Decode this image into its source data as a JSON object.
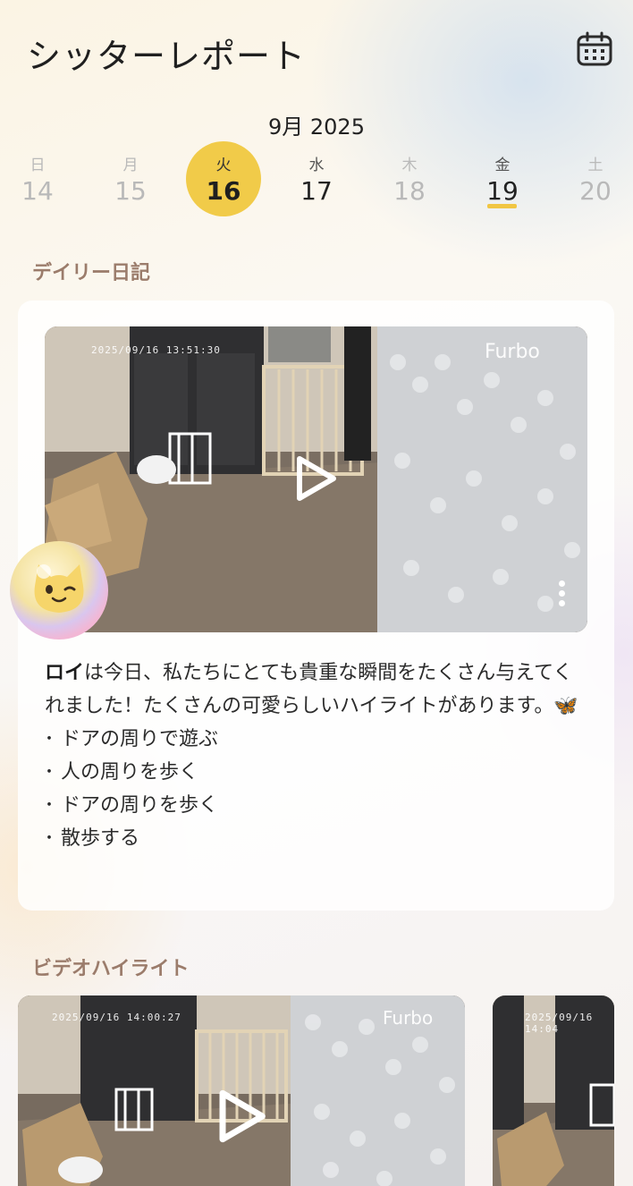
{
  "header": {
    "title": "シッターレポート",
    "calendar_icon": "calendar-icon"
  },
  "calendar": {
    "month_label": "9月 2025",
    "days": [
      {
        "dow": "日",
        "num": "14",
        "state": "disabled"
      },
      {
        "dow": "月",
        "num": "15",
        "state": "disabled"
      },
      {
        "dow": "火",
        "num": "16",
        "state": "selected"
      },
      {
        "dow": "水",
        "num": "17",
        "state": "available"
      },
      {
        "dow": "木",
        "num": "18",
        "state": "disabled"
      },
      {
        "dow": "金",
        "num": "19",
        "state": "today"
      },
      {
        "dow": "土",
        "num": "20",
        "state": "disabled"
      }
    ],
    "accent_color": "#f1cb49"
  },
  "daily_diary": {
    "section_title": "デイリー日記",
    "video": {
      "timestamp": "2025/09/16 13:51:30",
      "brand": "Furbo",
      "more_icon": "kebab-menu-icon"
    },
    "pet_name": "ロイ",
    "summary": "は今日、私たちにとても貴重な瞬間をたくさん与えてくれました！たくさんの可愛らしいハイライトがあります。🦋",
    "highlights": [
      "ドアの周りで遊ぶ",
      "人の周りを歩く",
      "ドアの周りを歩く",
      "散歩する"
    ]
  },
  "video_highlights": {
    "section_title": "ビデオハイライト",
    "items": [
      {
        "timestamp": "2025/09/16 14:00:27",
        "brand": "Furbo"
      },
      {
        "timestamp": "2025/09/16 14:04",
        "brand": ""
      }
    ]
  }
}
